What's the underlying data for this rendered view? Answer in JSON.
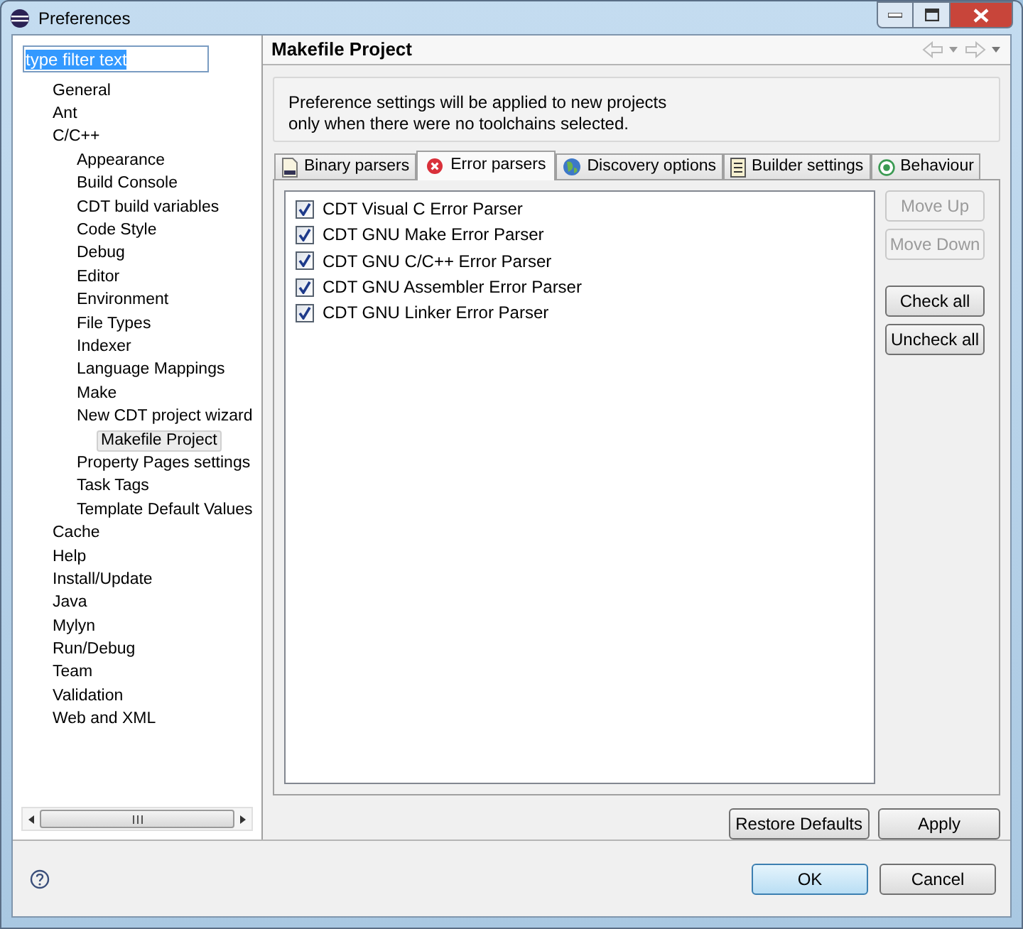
{
  "window": {
    "title": "Preferences"
  },
  "filter": {
    "value": "type filter text"
  },
  "tree": [
    {
      "label": "General",
      "selected": false
    },
    {
      "label": "Ant",
      "selected": false
    },
    {
      "label": "C/C++",
      "selected": false,
      "children": [
        {
          "label": "Appearance",
          "selected": false
        },
        {
          "label": "Build Console",
          "selected": false
        },
        {
          "label": "CDT build variables",
          "selected": false
        },
        {
          "label": "Code Style",
          "selected": false
        },
        {
          "label": "Debug",
          "selected": false
        },
        {
          "label": "Editor",
          "selected": false
        },
        {
          "label": "Environment",
          "selected": false
        },
        {
          "label": "File Types",
          "selected": false
        },
        {
          "label": "Indexer",
          "selected": false
        },
        {
          "label": "Language Mappings",
          "selected": false
        },
        {
          "label": "Make",
          "selected": false
        },
        {
          "label": "New CDT project wizard",
          "selected": false,
          "children": [
            {
              "label": "Makefile Project",
              "selected": true
            }
          ]
        },
        {
          "label": "Property Pages settings",
          "selected": false
        },
        {
          "label": "Task Tags",
          "selected": false
        },
        {
          "label": "Template Default Values",
          "selected": false
        }
      ]
    },
    {
      "label": "Cache",
      "selected": false
    },
    {
      "label": "Help",
      "selected": false
    },
    {
      "label": "Install/Update",
      "selected": false
    },
    {
      "label": "Java",
      "selected": false
    },
    {
      "label": "Mylyn",
      "selected": false
    },
    {
      "label": "Run/Debug",
      "selected": false
    },
    {
      "label": "Team",
      "selected": false
    },
    {
      "label": "Validation",
      "selected": false
    },
    {
      "label": "Web and XML",
      "selected": false
    }
  ],
  "page": {
    "title": "Makefile Project",
    "note": [
      "Preference settings will be applied to new projects",
      "only when there were no toolchains selected."
    ]
  },
  "tabs": [
    {
      "label": "Binary parsers",
      "selected": false
    },
    {
      "label": "Error parsers",
      "selected": true
    },
    {
      "label": "Discovery options",
      "selected": false
    },
    {
      "label": "Builder settings",
      "selected": false
    },
    {
      "label": "Behaviour",
      "selected": false
    }
  ],
  "parsers": [
    {
      "label": "CDT Visual C Error Parser",
      "checked": true
    },
    {
      "label": "CDT GNU Make Error Parser",
      "checked": true
    },
    {
      "label": "CDT GNU C/C++ Error Parser",
      "checked": true
    },
    {
      "label": "CDT GNU Assembler Error Parser",
      "checked": true
    },
    {
      "label": "CDT GNU Linker Error Parser",
      "checked": true
    }
  ],
  "side_buttons": [
    {
      "label": "Move Up",
      "disabled": true
    },
    {
      "label": "Move Down",
      "disabled": true
    },
    {
      "label": "Check all",
      "disabled": false
    },
    {
      "label": "Uncheck all",
      "disabled": false
    }
  ],
  "page_buttons": [
    "Restore Defaults",
    "Apply"
  ],
  "dialog_buttons": [
    {
      "label": "OK",
      "default": true
    },
    {
      "label": "Cancel",
      "default": false
    }
  ]
}
